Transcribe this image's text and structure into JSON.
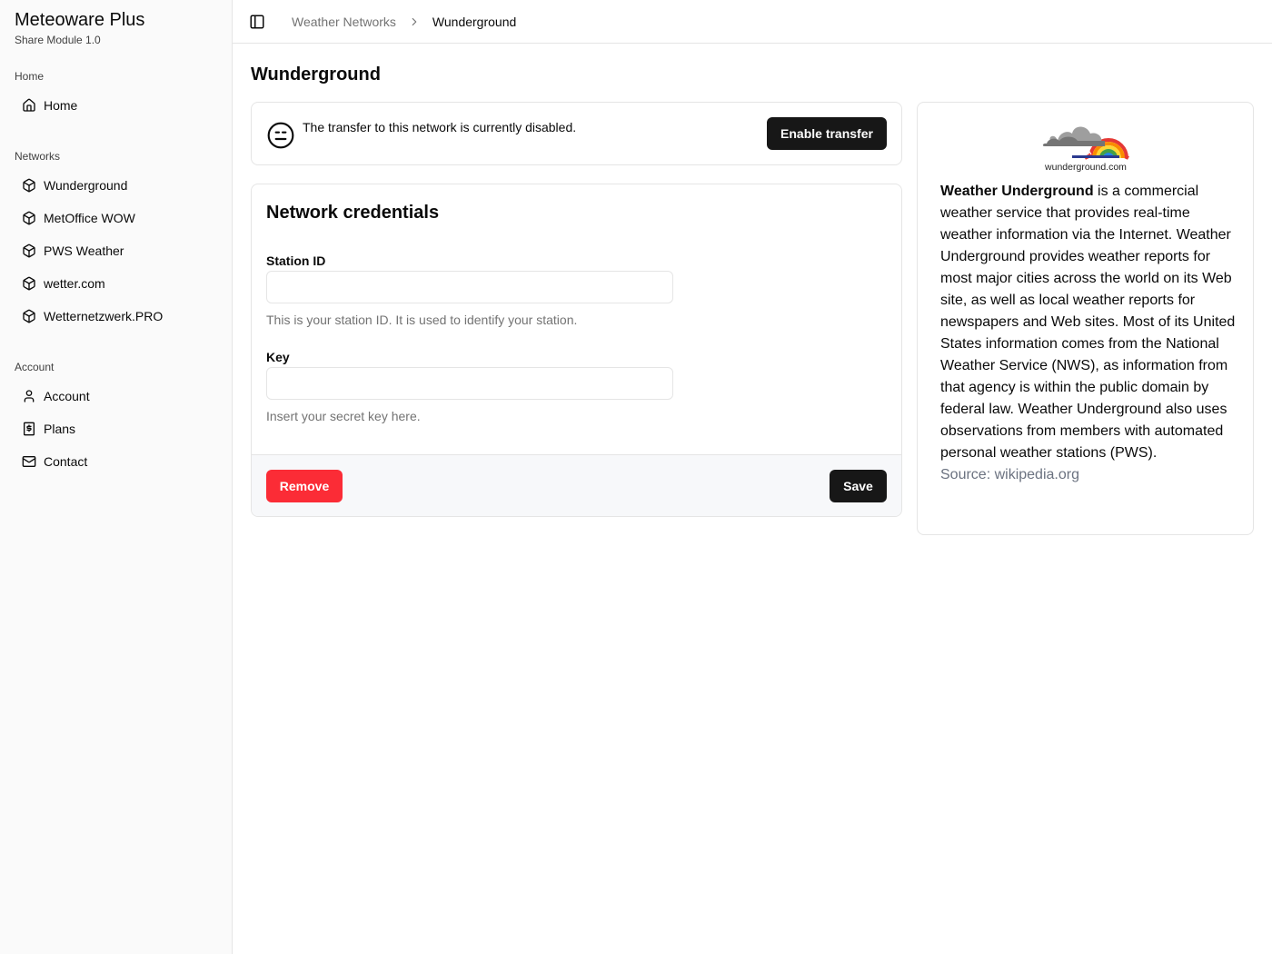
{
  "app": {
    "title": "Meteoware Plus",
    "subtitle": "Share Module 1.0"
  },
  "sidebar": {
    "groups": [
      {
        "label": "Home",
        "items": [
          {
            "label": "Home",
            "icon": "home-icon"
          }
        ]
      },
      {
        "label": "Networks",
        "items": [
          {
            "label": "Wunderground",
            "icon": "cube-icon"
          },
          {
            "label": "MetOffice WOW",
            "icon": "cube-icon"
          },
          {
            "label": "PWS Weather",
            "icon": "cube-icon"
          },
          {
            "label": "wetter.com",
            "icon": "cube-icon"
          },
          {
            "label": "Wetternetzwerk.PRO",
            "icon": "cube-icon"
          }
        ]
      },
      {
        "label": "Account",
        "items": [
          {
            "label": "Account",
            "icon": "user-icon"
          },
          {
            "label": "Plans",
            "icon": "dollar-receipt-icon"
          },
          {
            "label": "Contact",
            "icon": "mail-icon"
          }
        ]
      }
    ]
  },
  "header": {
    "breadcrumb": [
      "Weather Networks",
      "Wunderground"
    ]
  },
  "page": {
    "title": "Wunderground"
  },
  "alert": {
    "message": "The transfer to this network is currently disabled.",
    "button": "Enable transfer",
    "icon": "neutral-face-icon"
  },
  "credentials": {
    "title": "Network credentials",
    "station_id": {
      "label": "Station ID",
      "value": "",
      "help": "This is your station ID. It is used to identify your station."
    },
    "key": {
      "label": "Key",
      "value": "",
      "help": "Insert your secret key here."
    },
    "remove_label": "Remove",
    "save_label": "Save"
  },
  "info": {
    "logo_text": "wunderground.com",
    "name": "Weather Underground",
    "description": " is a commercial weather service that provides real-time weather information via the Internet. Weather Underground provides weather reports for most major cities across the world on its Web site, as well as local weather reports for newspapers and Web sites. Most of its United States information comes from the National Weather Service (NWS), as information from that agency is within the public domain by federal law. Weather Underground also uses observations from members with automated personal weather stations (PWS).",
    "source": "Source: wikipedia.org"
  },
  "colors": {
    "primary_button": "#171717",
    "danger_button": "#fb2c36",
    "sidebar_bg": "#fafafa",
    "border": "#e5e5e5"
  }
}
